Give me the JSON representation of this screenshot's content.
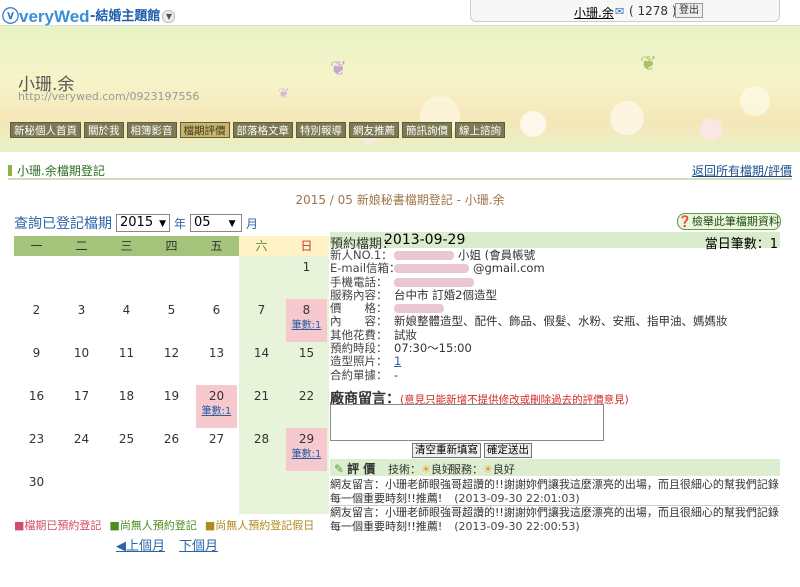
{
  "header": {
    "logo": "veryWed",
    "site_title": "-結婚主題館",
    "user_name": "小珊.余",
    "message_count": "( 1278 )",
    "logout_label": "登出"
  },
  "banner": {
    "name": "小珊.余",
    "url": "http://verywed.com/0923197556"
  },
  "nav": [
    "新秘個人首頁",
    "關於我",
    "相簿影音",
    "檔期評價",
    "部落格文章",
    "特別報導",
    "網友推薦",
    "簡訊詢價",
    "線上諮詢"
  ],
  "nav_active_index": 3,
  "section": {
    "title": "小珊.余檔期登記",
    "back_link": "返回所有檔期/評價"
  },
  "caption": "2015 / 05 新娘秘書檔期登記 - 小珊.余",
  "query": {
    "label": "查詢已登記檔期",
    "year": "2015",
    "year_unit": "年",
    "month": "05",
    "month_unit": "月"
  },
  "report_button": "檢舉此筆檔期資料",
  "calendar": {
    "weekdays": [
      "一",
      "二",
      "三",
      "四",
      "五",
      "六",
      "日"
    ],
    "weeks": [
      [
        "",
        "",
        "",
        "",
        "",
        "",
        "1"
      ],
      [
        "2",
        "3",
        "4",
        "5",
        "6",
        "7",
        "8"
      ],
      [
        "9",
        "10",
        "11",
        "12",
        "13",
        "14",
        "15"
      ],
      [
        "16",
        "17",
        "18",
        "19",
        "20",
        "21",
        "22"
      ],
      [
        "23",
        "24",
        "25",
        "26",
        "27",
        "28",
        "29"
      ],
      [
        "30",
        "",
        "",
        "",
        "",
        "",
        ""
      ]
    ],
    "marked_days": [
      "8",
      "20",
      "29"
    ],
    "mark_label": "筆數:1"
  },
  "legend": [
    "檔期已預約登記",
    "尚無人預約登記",
    "尚無人預約登記假日"
  ],
  "pager": {
    "prev": "上個月",
    "next": "下個月"
  },
  "detail": {
    "booking_label": "預約檔期：",
    "booking_date": "2013-09-29",
    "day_count": "當日筆數：1",
    "rows": [
      {
        "k": "新人NO.1：",
        "v": "小姐 (會員帳號",
        "redact": true
      },
      {
        "k": "E-mail信箱：",
        "v": "@gmail.com",
        "redact": true
      },
      {
        "k": "手機電話：",
        "v": "",
        "redact": true
      },
      {
        "k": "服務內容：",
        "v": "台中市 訂婚2個造型"
      },
      {
        "k": "價　　格：",
        "v": "",
        "redact": true
      },
      {
        "k": "內　　容：",
        "v": "新娘整體造型、配件、飾品、假髮、水粉、安瓶、指甲油、媽媽妝"
      },
      {
        "k": "其他花費：",
        "v": "試妝"
      },
      {
        "k": "預約時段：",
        "v": "07:30～15:00"
      },
      {
        "k": "造型照片：",
        "v": "1",
        "link": true
      },
      {
        "k": "合約單據：",
        "v": "-"
      }
    ],
    "message_label": "廠商留言：",
    "message_warning": "(意見只能新增不提供修改或刪除過去的評價意見)",
    "clear_button": "清空重新填寫",
    "submit_button": "確定送出",
    "evaluation_label": "評 價",
    "skill_label": "技術：",
    "skill_value": "良好",
    "service_label": "服務：",
    "service_value": "良好",
    "comments": [
      {
        "text": "網友留言：小珊老師眼強哥超讚的!!謝謝妳們讓我這麼漂亮的出場，而且很細心的幫我們記錄每一個重要時刻!!推薦!",
        "time": "(2013-09-30 22:01:03)"
      },
      {
        "text": "網友留言：小珊老師眼強哥超讚的!!謝謝妳們讓我這麼漂亮的出場，而且很細心的幫我們記錄每一個重要時刻!!推薦!",
        "time": "(2013-09-30 22:00:53)"
      }
    ]
  }
}
